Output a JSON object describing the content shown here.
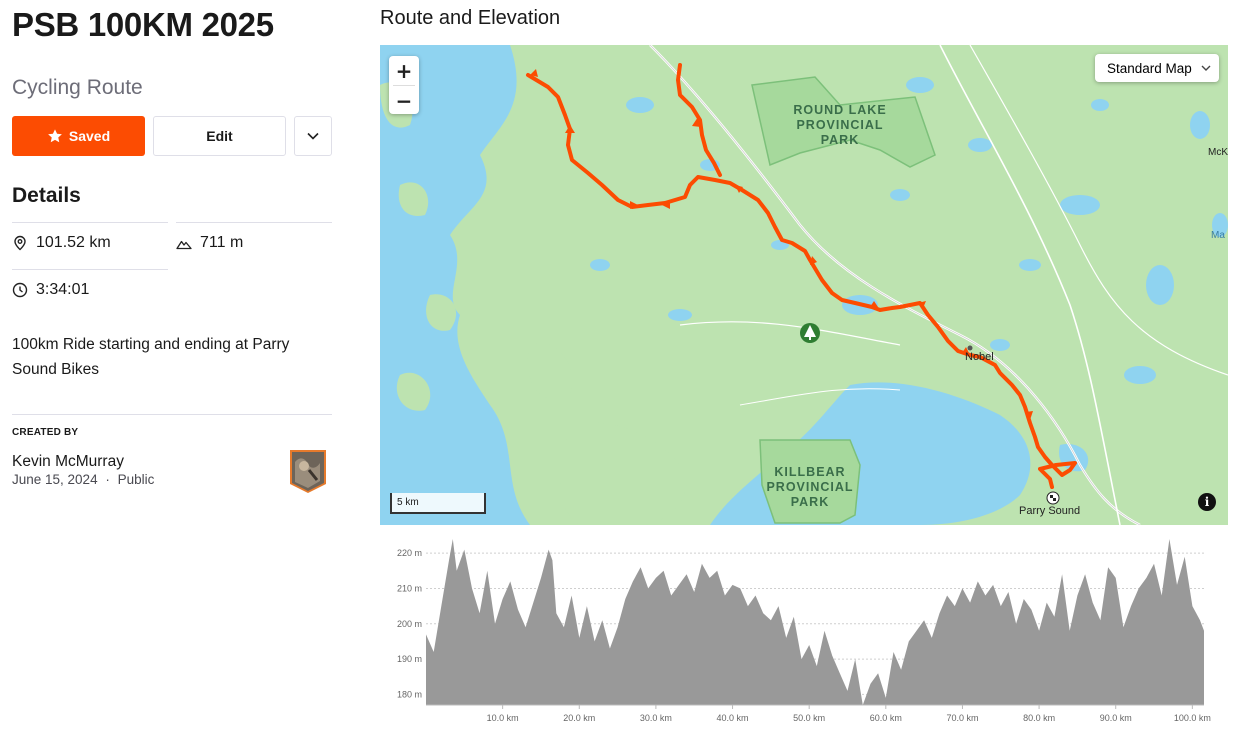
{
  "route": {
    "title": "PSB 100KM 2025",
    "type": "Cycling Route"
  },
  "actions": {
    "saved_label": "Saved",
    "edit_label": "Edit"
  },
  "details": {
    "heading": "Details",
    "distance": "101.52 km",
    "elevation_gain": "711 m",
    "time": "3:34:01",
    "description": "100km Ride starting and ending at Parry Sound Bikes"
  },
  "creator": {
    "heading": "CREATED BY",
    "name": "Kevin McMurray",
    "date": "June 15, 2024",
    "separator": "·",
    "visibility": "Public"
  },
  "map": {
    "heading": "Route and Elevation",
    "map_type": "Standard Map",
    "zoom_in": "+",
    "zoom_out": "−",
    "scale_label": "5 km",
    "info": "i",
    "labels": {
      "round_lake": "ROUND LAKE PROVINCIAL PARK",
      "killbear": "KILLBEAR PROVINCIAL PARK",
      "nobel": "Nobel",
      "parry_sound": "Parry Sound",
      "mck": "McK",
      "ma": "Ma"
    },
    "colors": {
      "water": "#8fd3f0",
      "land": "#bde3b0",
      "route": "#fc4c02"
    }
  },
  "chart_data": {
    "type": "area",
    "xlabel": "",
    "ylabel": "",
    "x_ticks": [
      "10.0 km",
      "20.0 km",
      "30.0 km",
      "40.0 km",
      "50.0 km",
      "60.0 km",
      "70.0 km",
      "80.0 km",
      "90.0 km",
      "100.0 km"
    ],
    "y_ticks": [
      "180 m",
      "190 m",
      "200 m",
      "210 m",
      "220 m"
    ],
    "xlim": [
      0,
      101.52
    ],
    "ylim": [
      177,
      224
    ],
    "series": [
      {
        "x": [
          0,
          1,
          2,
          3,
          3.5,
          4,
          5,
          6,
          7,
          8,
          9,
          10,
          11,
          12,
          13,
          14,
          15,
          16,
          16.5,
          17,
          18,
          19,
          20,
          21,
          22,
          23,
          24,
          25,
          26,
          27,
          28,
          29,
          30,
          31,
          32,
          33,
          34,
          35,
          36,
          37,
          38,
          39,
          40,
          41,
          42,
          43,
          44,
          45,
          46,
          47,
          48,
          49,
          50,
          51,
          52,
          53,
          54,
          55,
          56,
          57,
          58,
          59,
          60,
          61,
          62,
          63,
          64,
          65,
          66,
          67,
          68,
          69,
          70,
          71,
          72,
          73,
          74,
          75,
          76,
          77,
          78,
          79,
          80,
          81,
          82,
          83,
          84,
          85,
          86,
          87,
          88,
          89,
          90,
          91,
          92,
          93,
          94,
          95,
          96,
          97,
          98,
          99,
          100,
          101,
          101.52
        ],
        "y": [
          197,
          192,
          205,
          218,
          224,
          215,
          221,
          210,
          203,
          215,
          200,
          207,
          212,
          204,
          199,
          206,
          213,
          221,
          218,
          203,
          199,
          208,
          196,
          205,
          195,
          201,
          193,
          199,
          207,
          212,
          216,
          210,
          213,
          215,
          208,
          211,
          214,
          209,
          217,
          213,
          215,
          208,
          211,
          210,
          205,
          208,
          203,
          201,
          205,
          196,
          202,
          190,
          194,
          188,
          198,
          191,
          186,
          181,
          190,
          177,
          183,
          186,
          179,
          192,
          187,
          195,
          198,
          201,
          196,
          203,
          208,
          205,
          210,
          206,
          212,
          208,
          211,
          205,
          209,
          200,
          207,
          204,
          198,
          206,
          202,
          214,
          198,
          208,
          214,
          206,
          201,
          216,
          213,
          199,
          205,
          210,
          213,
          217,
          208,
          224,
          211,
          219,
          205,
          201,
          198
        ]
      }
    ]
  }
}
